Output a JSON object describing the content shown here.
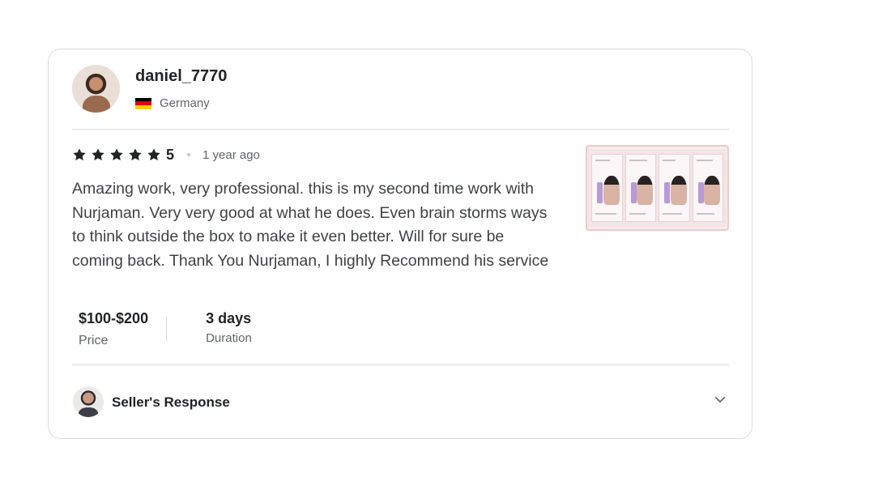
{
  "review": {
    "username": "daniel_7770",
    "country": "Germany",
    "rating": "5",
    "rating_value": 5,
    "time_ago": "1 year ago",
    "text": "Amazing work, very professional. this is my second time work with Nurjaman. Very very good at what he does. Even brain storms ways to think outside the box to make it even better. Will for sure be coming back. Thank You Nurjaman, I highly Recommend his service",
    "price": {
      "value": "$100-$200",
      "label": "Price"
    },
    "duration": {
      "value": "3 days",
      "label": "Duration"
    }
  },
  "seller_response": {
    "label": "Seller's Response"
  },
  "colors": {
    "star": "#222325",
    "flag_black": "#000000",
    "flag_red": "#dd0000",
    "flag_gold": "#ffce00",
    "border": "#dadbdd"
  },
  "icons": {
    "star": "star-icon",
    "flag": "germany-flag-icon",
    "chevron": "chevron-down-icon"
  }
}
